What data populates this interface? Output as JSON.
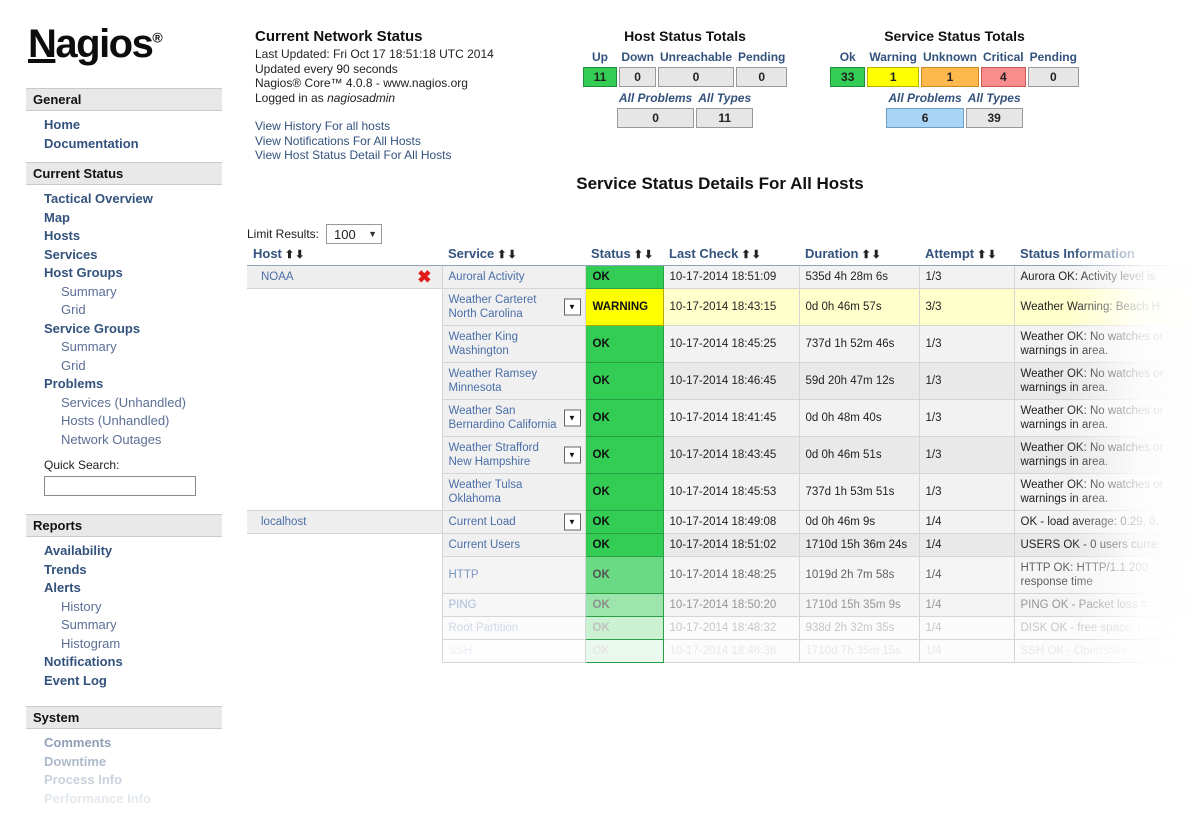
{
  "brand": {
    "name_u": "N",
    "name_rest": "agios",
    "registered": "®"
  },
  "sidebar": {
    "sections": [
      {
        "heading": "General",
        "items": [
          {
            "label": "Home",
            "sub": false
          },
          {
            "label": "Documentation",
            "sub": false
          }
        ]
      },
      {
        "heading": "Current Status",
        "items": [
          {
            "label": "Tactical Overview",
            "sub": false
          },
          {
            "label": "Map",
            "sub": false
          },
          {
            "label": "Hosts",
            "sub": false
          },
          {
            "label": "Services",
            "sub": false
          },
          {
            "label": "Host Groups",
            "sub": false
          },
          {
            "label": "Summary",
            "sub": true
          },
          {
            "label": "Grid",
            "sub": true
          },
          {
            "label": "Service Groups",
            "sub": false
          },
          {
            "label": "Summary",
            "sub": true
          },
          {
            "label": "Grid",
            "sub": true
          },
          {
            "label": "Problems",
            "sub": false
          },
          {
            "label": "Services (Unhandled)",
            "sub": true
          },
          {
            "label": "Hosts (Unhandled)",
            "sub": true
          },
          {
            "label": "Network Outages",
            "sub": true
          }
        ]
      },
      {
        "heading": "Reports",
        "items": [
          {
            "label": "Availability",
            "sub": false
          },
          {
            "label": "Trends",
            "sub": false
          },
          {
            "label": "Alerts",
            "sub": false
          },
          {
            "label": "History",
            "sub": true
          },
          {
            "label": "Summary",
            "sub": true
          },
          {
            "label": "Histogram",
            "sub": true
          },
          {
            "label": "Notifications",
            "sub": false
          },
          {
            "label": "Event Log",
            "sub": false
          }
        ]
      },
      {
        "heading": "System",
        "items": [
          {
            "label": "Comments",
            "sub": false
          },
          {
            "label": "Downtime",
            "sub": false
          },
          {
            "label": "Process Info",
            "sub": false
          },
          {
            "label": "Performance Info",
            "sub": false
          }
        ]
      }
    ],
    "quick_search": {
      "label": "Quick Search:",
      "value": "",
      "placeholder": ""
    }
  },
  "status_summary": {
    "title": "Current Network Status",
    "last_updated": "Last Updated: Fri Oct 17 18:51:18 UTC 2014",
    "update_interval": "Updated every 90 seconds",
    "version": "Nagios® Core™ 4.0.8 - www.nagios.org",
    "logged_in_prefix": "Logged in as ",
    "logged_in_user": "nagiosadmin",
    "links": [
      "View History For all hosts",
      "View Notifications For All Hosts",
      "View Host Status Detail For All Hosts"
    ]
  },
  "host_totals": {
    "title": "Host Status Totals",
    "columns": [
      "Up",
      "Down",
      "Unreachable",
      "Pending"
    ],
    "values": [
      "11",
      "0",
      "0",
      "0"
    ],
    "all_problems_label": "All Problems",
    "all_types_label": "All Types",
    "all_problems": "0",
    "all_types": "11"
  },
  "service_totals": {
    "title": "Service Status Totals",
    "columns": [
      "Ok",
      "Warning",
      "Unknown",
      "Critical",
      "Pending"
    ],
    "values": [
      "33",
      "1",
      "1",
      "4",
      "0"
    ],
    "all_problems_label": "All Problems",
    "all_types_label": "All Types",
    "all_problems": "6",
    "all_types": "39"
  },
  "main": {
    "page_title": "Service Status Details For All Hosts",
    "limit_results_label": "Limit Results:",
    "limit_results_value": "100",
    "limit_results_options": [
      "100"
    ],
    "columns": [
      "Host",
      "Service",
      "Status",
      "Last Check",
      "Duration",
      "Attempt",
      "Status Information"
    ],
    "rows": [
      {
        "host": "NOAA",
        "host_ack_icon": "red-x-icon",
        "service": "Auroral Activity",
        "has_dropdown": false,
        "status": "OK",
        "status_kind": "ok",
        "last_check": "10-17-2014 18:51:09",
        "duration": "535d 4h 28m 6s",
        "attempt": "1/3",
        "info": "Aurora OK: Activity level is",
        "row_kind": "ok",
        "fade": 0
      },
      {
        "host": "",
        "host_ack_icon": "",
        "service": "Weather Carteret North Carolina",
        "has_dropdown": true,
        "status": "WARNING",
        "status_kind": "warning",
        "last_check": "10-17-2014 18:43:15",
        "duration": "0d 0h 46m 57s",
        "attempt": "3/3",
        "info": "Weather Warning: Beach H",
        "row_kind": "warning",
        "fade": 0
      },
      {
        "host": "",
        "host_ack_icon": "",
        "service": "Weather King Washington",
        "has_dropdown": false,
        "status": "OK",
        "status_kind": "ok",
        "last_check": "10-17-2014 18:45:25",
        "duration": "737d 1h 52m 46s",
        "attempt": "1/3",
        "info": "Weather OK: No watches or warnings in area.",
        "row_kind": "ok",
        "fade": 0
      },
      {
        "host": "",
        "host_ack_icon": "",
        "service": "Weather Ramsey Minnesota",
        "has_dropdown": false,
        "status": "OK",
        "status_kind": "ok",
        "last_check": "10-17-2014 18:46:45",
        "duration": "59d 20h 47m 12s",
        "attempt": "1/3",
        "info": "Weather OK: No watches or warnings in area.",
        "row_kind": "alt",
        "fade": 0
      },
      {
        "host": "",
        "host_ack_icon": "",
        "service": "Weather San Bernardino California",
        "has_dropdown": true,
        "status": "OK",
        "status_kind": "ok",
        "last_check": "10-17-2014 18:41:45",
        "duration": "0d 0h 48m 40s",
        "attempt": "1/3",
        "info": "Weather OK: No watches or warnings in area.",
        "row_kind": "ok",
        "fade": 0
      },
      {
        "host": "",
        "host_ack_icon": "",
        "service": "Weather Strafford New Hampshire",
        "has_dropdown": true,
        "status": "OK",
        "status_kind": "ok",
        "last_check": "10-17-2014 18:43:45",
        "duration": "0d 0h 46m 51s",
        "attempt": "1/3",
        "info": "Weather OK: No watches or warnings in area.",
        "row_kind": "alt",
        "fade": 0
      },
      {
        "host": "",
        "host_ack_icon": "",
        "service": "Weather Tulsa Oklahoma",
        "has_dropdown": false,
        "status": "OK",
        "status_kind": "ok",
        "last_check": "10-17-2014 18:45:53",
        "duration": "737d 1h 53m 51s",
        "attempt": "1/3",
        "info": "Weather OK: No watches or warnings in area.",
        "row_kind": "ok",
        "fade": 0
      },
      {
        "host": "localhost",
        "host_ack_icon": "",
        "service": "Current Load",
        "has_dropdown": true,
        "status": "OK",
        "status_kind": "ok",
        "last_check": "10-17-2014 18:49:08",
        "duration": "0d 0h 46m 9s",
        "attempt": "1/4",
        "info": "OK - load average: 0.29, 0.",
        "row_kind": "ok",
        "fade": 0
      },
      {
        "host": "",
        "host_ack_icon": "",
        "service": "Current Users",
        "has_dropdown": false,
        "status": "OK",
        "status_kind": "ok",
        "last_check": "10-17-2014 18:51:02",
        "duration": "1710d 15h 36m 24s",
        "attempt": "1/4",
        "info": "USERS OK - 0 users curre",
        "row_kind": "alt",
        "fade": 0
      },
      {
        "host": "",
        "host_ack_icon": "",
        "service": "HTTP",
        "has_dropdown": false,
        "status": "OK",
        "status_kind": "ok",
        "last_check": "10-17-2014 18:48:25",
        "duration": "1019d 2h 7m 58s",
        "attempt": "1/4",
        "info": "HTTP OK: HTTP/1.1 200 response time",
        "row_kind": "ok",
        "fade": 1
      },
      {
        "host": "",
        "host_ack_icon": "",
        "service": "PING",
        "has_dropdown": false,
        "status": "OK",
        "status_kind": "ok",
        "last_check": "10-17-2014 18:50:20",
        "duration": "1710d 15h 35m 9s",
        "attempt": "1/4",
        "info": "PING OK - Packet loss =",
        "row_kind": "alt",
        "fade": 2
      },
      {
        "host": "",
        "host_ack_icon": "",
        "service": "Root Partition",
        "has_dropdown": false,
        "status": "OK",
        "status_kind": "ok",
        "last_check": "10-17-2014 18:48:32",
        "duration": "938d 2h 32m 35s",
        "attempt": "1/4",
        "info": "DISK OK - free space: /",
        "row_kind": "ok",
        "fade": 3
      },
      {
        "host": "",
        "host_ack_icon": "",
        "service": "SSH",
        "has_dropdown": false,
        "status": "OK",
        "status_kind": "ok",
        "last_check": "10-17-2014 18:46:38",
        "duration": "1710d 7h 35m 15s",
        "attempt": "1/4",
        "info": "SSH OK - OpenSSH",
        "row_kind": "alt",
        "fade": 4
      }
    ]
  },
  "icons": {
    "sort_up": "⬆",
    "sort_down": "⬇",
    "caret_down": "▼",
    "red_x": "✖"
  }
}
